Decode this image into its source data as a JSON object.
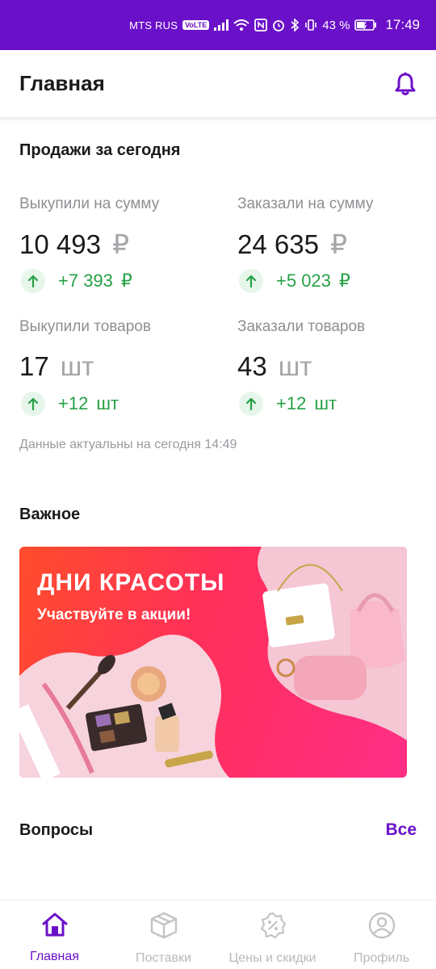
{
  "status_bar": {
    "carrier": "MTS RUS",
    "volte": "VoLTE",
    "battery": "43 %",
    "time": "17:49"
  },
  "app_bar": {
    "title": "Главная",
    "icon": "bell-icon"
  },
  "sales_today": {
    "title": "Продажи за сегодня",
    "metrics": [
      {
        "label": "Выкупили на сумму",
        "value": "10 493",
        "unit": "₽",
        "delta": "+7 393",
        "delta_unit": "₽"
      },
      {
        "label": "Заказали на сумму",
        "value": "24 635",
        "unit": "₽",
        "delta": "+5 023",
        "delta_unit": "₽"
      },
      {
        "label": "Выкупили товаров",
        "value": "17",
        "unit": "шт",
        "delta": "+12",
        "delta_unit": "шт"
      },
      {
        "label": "Заказали товаров",
        "value": "43",
        "unit": "шт",
        "delta": "+12",
        "delta_unit": "шт"
      }
    ],
    "updated": "Данные актуальны на сегодня 14:49"
  },
  "important": {
    "title": "Важное",
    "banner": {
      "title": "ДНИ КРАСОТЫ",
      "subtitle": "Участвуйте в акции!"
    }
  },
  "questions": {
    "title": "Вопросы",
    "all_link": "Все"
  },
  "bottom_nav": {
    "items": [
      {
        "label": "Главная",
        "icon": "home-icon",
        "active": true
      },
      {
        "label": "Поставки",
        "icon": "box-icon",
        "active": false
      },
      {
        "label": "Цены и скидки",
        "icon": "discount-icon",
        "active": false
      },
      {
        "label": "Профиль",
        "icon": "profile-icon",
        "active": false
      }
    ]
  },
  "colors": {
    "brand": "#6b10c9",
    "positive": "#26a045"
  }
}
